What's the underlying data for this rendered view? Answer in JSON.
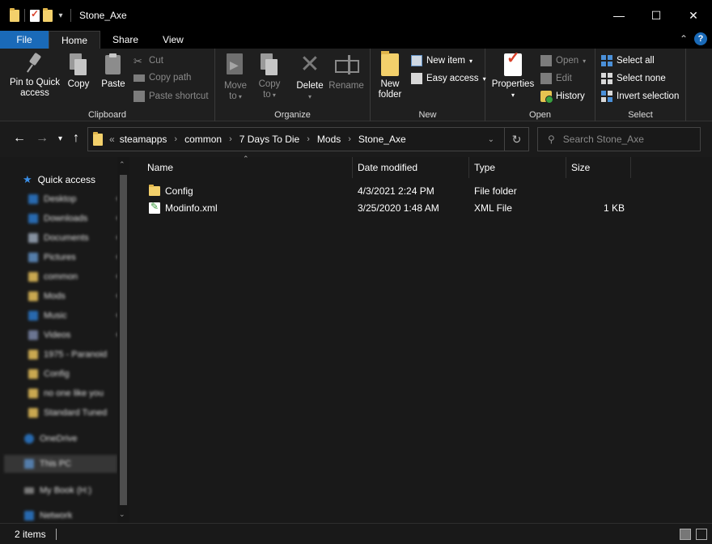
{
  "window": {
    "title": "Stone_Axe",
    "minimize": "—",
    "maximize": "☐",
    "close": "✕"
  },
  "tabs": [
    {
      "label": "File"
    },
    {
      "label": "Home"
    },
    {
      "label": "Share"
    },
    {
      "label": "View"
    }
  ],
  "ribbon": {
    "clipboard": {
      "label": "Clipboard",
      "pin_line1": "Pin to Quick",
      "pin_line2": "access",
      "copy": "Copy",
      "paste": "Paste",
      "cut": "Cut",
      "copy_path": "Copy path",
      "paste_shortcut": "Paste shortcut"
    },
    "organize": {
      "label": "Organize",
      "move_to_line1": "Move",
      "move_to_line2": "to",
      "copy_to_line1": "Copy",
      "copy_to_line2": "to",
      "delete": "Delete",
      "rename": "Rename"
    },
    "new": {
      "label": "New",
      "new_folder_line1": "New",
      "new_folder_line2": "folder",
      "new_item": "New item",
      "easy_access": "Easy access"
    },
    "open": {
      "label": "Open",
      "properties": "Properties",
      "open": "Open",
      "edit": "Edit",
      "history": "History"
    },
    "select": {
      "label": "Select",
      "select_all": "Select all",
      "select_none": "Select none",
      "invert_selection": "Invert selection"
    }
  },
  "address": {
    "overflow": "«",
    "crumbs": [
      "steamapps",
      "common",
      "7 Days To Die",
      "Mods",
      "Stone_Axe"
    ]
  },
  "search": {
    "placeholder": "Search Stone_Axe"
  },
  "sidebar": {
    "quick_access": "Quick access",
    "items": [
      {
        "label": "Desktop",
        "icon": "desktop-icon",
        "color": "#2b78c9"
      },
      {
        "label": "Downloads",
        "icon": "download-icon",
        "color": "#2b78c9"
      },
      {
        "label": "Documents",
        "icon": "documents-icon",
        "color": "#9aa7b8"
      },
      {
        "label": "Pictures",
        "icon": "pictures-icon",
        "color": "#5f8fc4"
      },
      {
        "label": "common",
        "icon": "folder-icon",
        "color": "#e8c15a"
      },
      {
        "label": "Mods",
        "icon": "folder-icon",
        "color": "#e8c15a"
      },
      {
        "label": "Music",
        "icon": "music-icon",
        "color": "#2b78c9"
      },
      {
        "label": "Videos",
        "icon": "videos-icon",
        "color": "#7a86a8"
      },
      {
        "label": "1975 - Paranoid",
        "icon": "folder-icon",
        "color": "#e8c15a"
      },
      {
        "label": "Config",
        "icon": "folder-icon",
        "color": "#e8c15a"
      },
      {
        "label": "no one like you",
        "icon": "folder-icon",
        "color": "#e8c15a"
      },
      {
        "label": "Standard Tuned",
        "icon": "folder-icon",
        "color": "#e8c15a"
      }
    ],
    "onedrive": "OneDrive",
    "this_pc": "This PC",
    "my_book": "My Book (H:)",
    "network": "Network"
  },
  "columns": {
    "name": "Name",
    "date_modified": "Date modified",
    "type": "Type",
    "size": "Size"
  },
  "files": [
    {
      "name": "Config",
      "date_modified": "4/3/2021 2:24 PM",
      "type": "File folder",
      "size": "",
      "icon": "folder-icon"
    },
    {
      "name": "Modinfo.xml",
      "date_modified": "3/25/2020 1:48 AM",
      "type": "XML File",
      "size": "1 KB",
      "icon": "xml-file-icon"
    }
  ],
  "status": {
    "item_count": "2 items"
  },
  "colors": {
    "accent": "#1a6ab8",
    "background": "#191919",
    "ribbon": "#1f1f1f",
    "folder": "#f3d06b"
  }
}
